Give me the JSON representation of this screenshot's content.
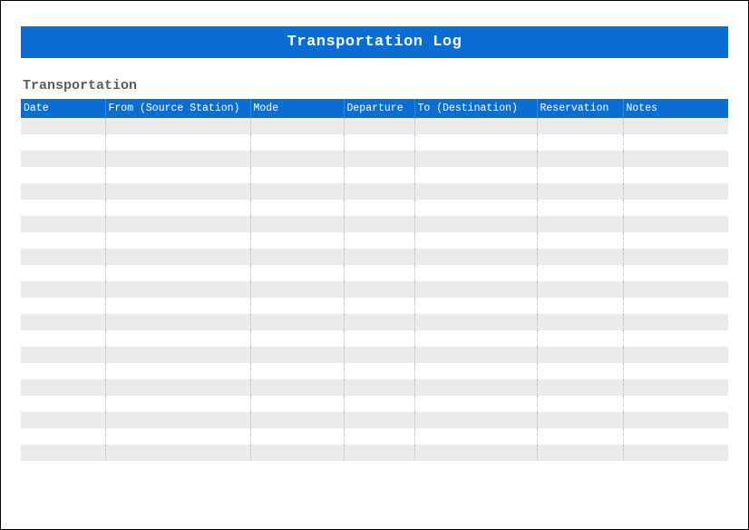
{
  "header": {
    "title": "Transportation Log"
  },
  "section": {
    "label": "Transportation"
  },
  "columns": [
    "Date",
    "From (Source Station)",
    "Mode",
    "Departure",
    "To (Destination)",
    "Reservation",
    "Notes"
  ],
  "rows": [
    {
      "date": "",
      "from": "",
      "mode": "",
      "departure": "",
      "to": "",
      "reservation": "",
      "notes": ""
    },
    {
      "date": "",
      "from": "",
      "mode": "",
      "departure": "",
      "to": "",
      "reservation": "",
      "notes": ""
    },
    {
      "date": "",
      "from": "",
      "mode": "",
      "departure": "",
      "to": "",
      "reservation": "",
      "notes": ""
    },
    {
      "date": "",
      "from": "",
      "mode": "",
      "departure": "",
      "to": "",
      "reservation": "",
      "notes": ""
    },
    {
      "date": "",
      "from": "",
      "mode": "",
      "departure": "",
      "to": "",
      "reservation": "",
      "notes": ""
    },
    {
      "date": "",
      "from": "",
      "mode": "",
      "departure": "",
      "to": "",
      "reservation": "",
      "notes": ""
    },
    {
      "date": "",
      "from": "",
      "mode": "",
      "departure": "",
      "to": "",
      "reservation": "",
      "notes": ""
    },
    {
      "date": "",
      "from": "",
      "mode": "",
      "departure": "",
      "to": "",
      "reservation": "",
      "notes": ""
    },
    {
      "date": "",
      "from": "",
      "mode": "",
      "departure": "",
      "to": "",
      "reservation": "",
      "notes": ""
    },
    {
      "date": "",
      "from": "",
      "mode": "",
      "departure": "",
      "to": "",
      "reservation": "",
      "notes": ""
    },
    {
      "date": "",
      "from": "",
      "mode": "",
      "departure": "",
      "to": "",
      "reservation": "",
      "notes": ""
    },
    {
      "date": "",
      "from": "",
      "mode": "",
      "departure": "",
      "to": "",
      "reservation": "",
      "notes": ""
    },
    {
      "date": "",
      "from": "",
      "mode": "",
      "departure": "",
      "to": "",
      "reservation": "",
      "notes": ""
    },
    {
      "date": "",
      "from": "",
      "mode": "",
      "departure": "",
      "to": "",
      "reservation": "",
      "notes": ""
    },
    {
      "date": "",
      "from": "",
      "mode": "",
      "departure": "",
      "to": "",
      "reservation": "",
      "notes": ""
    },
    {
      "date": "",
      "from": "",
      "mode": "",
      "departure": "",
      "to": "",
      "reservation": "",
      "notes": ""
    },
    {
      "date": "",
      "from": "",
      "mode": "",
      "departure": "",
      "to": "",
      "reservation": "",
      "notes": ""
    },
    {
      "date": "",
      "from": "",
      "mode": "",
      "departure": "",
      "to": "",
      "reservation": "",
      "notes": ""
    },
    {
      "date": "",
      "from": "",
      "mode": "",
      "departure": "",
      "to": "",
      "reservation": "",
      "notes": ""
    },
    {
      "date": "",
      "from": "",
      "mode": "",
      "departure": "",
      "to": "",
      "reservation": "",
      "notes": ""
    },
    {
      "date": "",
      "from": "",
      "mode": "",
      "departure": "",
      "to": "",
      "reservation": "",
      "notes": ""
    }
  ]
}
